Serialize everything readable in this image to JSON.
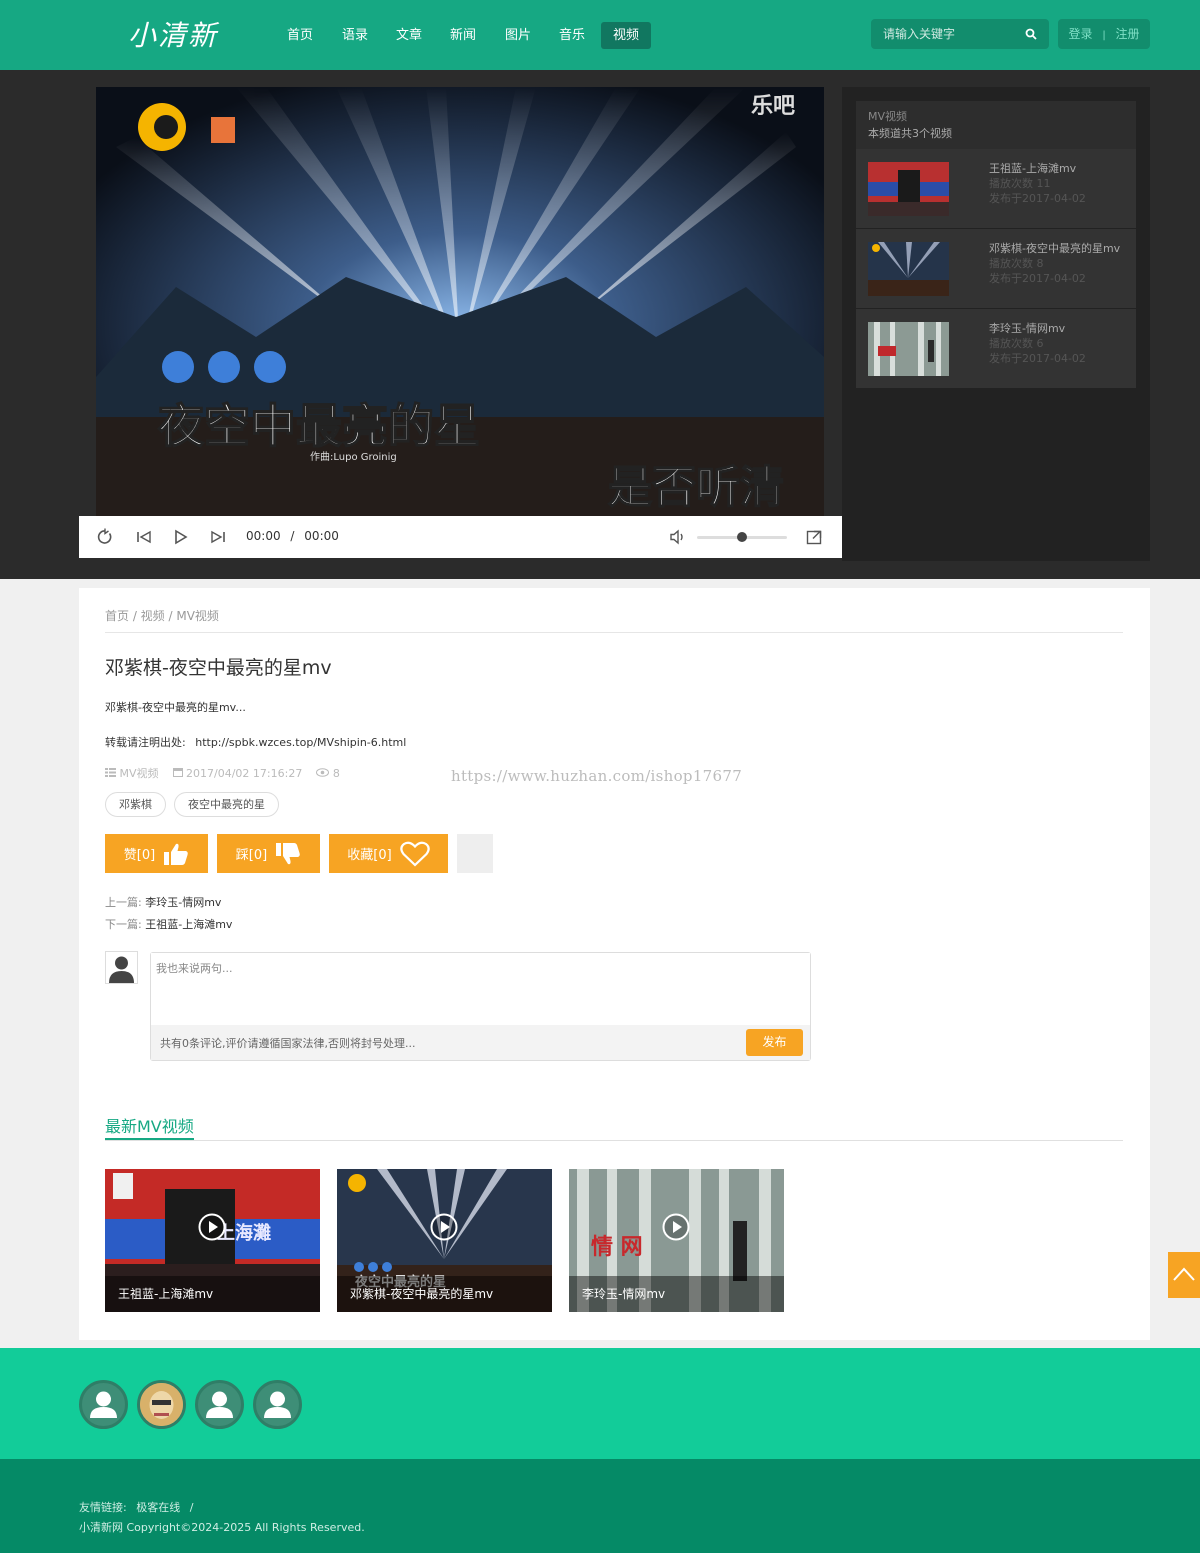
{
  "header": {
    "logo": "小清新",
    "nav": [
      "首页",
      "语录",
      "文章",
      "新闻",
      "图片",
      "音乐",
      "视频"
    ],
    "active_nav": "视频",
    "search_placeholder": "请输入关键字",
    "login": "登录",
    "separator": "|",
    "register": "注册"
  },
  "video": {
    "channel_logo": "乐吧",
    "overlay_title": "夜空中最亮的星",
    "overlay_subtitle": "是否听清",
    "credits": "作曲:Lupo Groinig",
    "time_current": "00:00",
    "time_sep": "/",
    "time_total": "00:00",
    "volume_fraction": 0.5
  },
  "playlist": {
    "category": "MV视频",
    "summary": "本频道共3个视频",
    "items": [
      {
        "title": "王祖蓝-上海滩mv",
        "plays": "播放次数 11",
        "date": "发布于2017-04-02"
      },
      {
        "title": "邓紫棋-夜空中最亮的星mv",
        "plays": "播放次数 8",
        "date": "发布于2017-04-02"
      },
      {
        "title": "李玲玉-情网mv",
        "plays": "播放次数 6",
        "date": "发布于2017-04-02"
      }
    ]
  },
  "article": {
    "breadcrumb": "首页 / 视频 / MV视频",
    "title": "邓紫棋-夜空中最亮的星mv",
    "description": "邓紫棋-夜空中最亮的星mv...",
    "source_label": "转载请注明出处:",
    "source_url": "http://spbk.wzces.top/MVshipin-6.html",
    "meta_category": "MV视频",
    "meta_date": "2017/04/02 17:16:27",
    "meta_views": "8",
    "tags": [
      "邓紫棋",
      "夜空中最亮的星"
    ],
    "like_label": "赞[0]",
    "dislike_label": "踩[0]",
    "fav_label": "收藏[0]",
    "prev_label": "上一篇:",
    "prev_title": "李玲玉-情网mv",
    "next_label": "下一篇:",
    "next_title": "王祖蓝-上海滩mv"
  },
  "comment": {
    "placeholder": "我也来说两句...",
    "tip": "共有0条评论,评价请遵循国家法律,否则将封号处理...",
    "submit": "发布"
  },
  "latest": {
    "title": "最新MV视频",
    "items": [
      {
        "caption": "王祖蓝-上海滩mv",
        "poster_title": "上海灘"
      },
      {
        "caption": "邓紫棋-夜空中最亮的星mv",
        "poster_title": "夜空中最亮的星"
      },
      {
        "caption": "李玲玉-情网mv",
        "poster_title": "情 网"
      }
    ]
  },
  "watermark": "https://www.huzhan.com/ishop17677",
  "footer": {
    "friend_label": "友情链接:",
    "friend_link": "极客在线",
    "friend_sep": "/",
    "site_name": "小清新网",
    "copyright": "Copyright©2024-2025 All Rights Reserved."
  },
  "colors": {
    "brand": "#16a883",
    "accent": "#f7a423",
    "footer_band": "#12cc99",
    "footer_bottom": "#058a66"
  }
}
